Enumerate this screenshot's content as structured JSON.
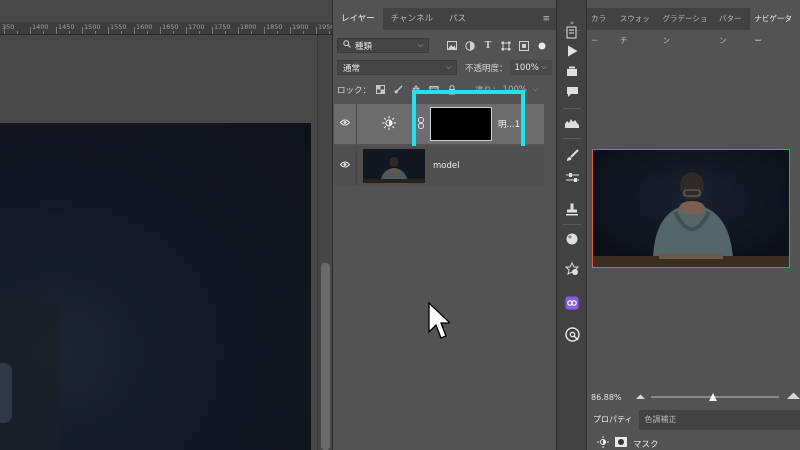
{
  "canvas": {
    "ruler_labels": [
      "350",
      "1400",
      "1450",
      "1500",
      "1550",
      "1600",
      "1650",
      "1700",
      "1750",
      "1800",
      "1850",
      "1900",
      "1950"
    ]
  },
  "layers_panel": {
    "tabs": [
      {
        "label": "レイヤー",
        "active": true
      },
      {
        "label": "チャンネル",
        "active": false
      },
      {
        "label": "パス",
        "active": false
      }
    ],
    "filter": {
      "label": "種類"
    },
    "blend_mode": "通常",
    "opacity": {
      "label": "不透明度：",
      "value": "100%"
    },
    "lock_label": "ロック：",
    "fill": {
      "label": "塗り：",
      "value": "100%"
    },
    "layers": [
      {
        "name": "明...1",
        "type": "adjustment",
        "selected": true
      },
      {
        "name": "model",
        "type": "photo",
        "selected": false
      }
    ]
  },
  "highlight_color": "#1de4ef",
  "navigator_panel": {
    "tabs": [
      {
        "label": "カラー",
        "active": false
      },
      {
        "label": "スウォッチ",
        "active": false
      },
      {
        "label": "グラデーション",
        "active": false
      },
      {
        "label": "パターン",
        "active": false
      },
      {
        "label": "ナビゲーター",
        "active": true
      }
    ],
    "zoom": "86.88%",
    "zoom_slider_position": 0.47
  },
  "properties_panel": {
    "tabs": [
      {
        "label": "プロパティ",
        "active": true
      },
      {
        "label": "色調補正",
        "active": false
      }
    ],
    "mask_label": "マスク"
  }
}
